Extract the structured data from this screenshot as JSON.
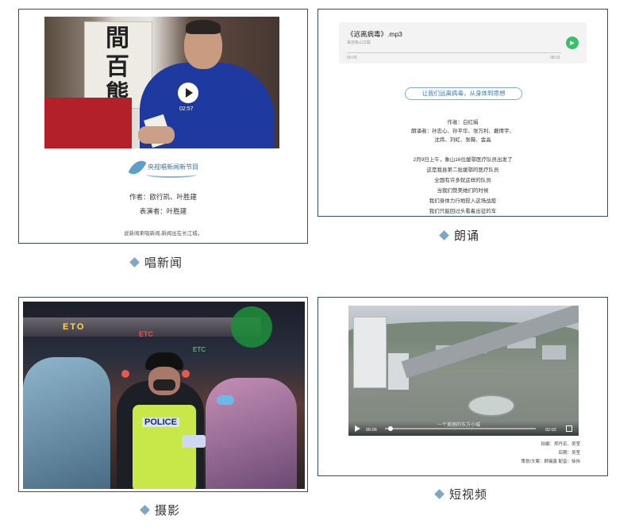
{
  "card1": {
    "calligraphy": [
      "間",
      "百",
      "態"
    ],
    "video_time": "02:57",
    "badge": "央视唱新闻新节目",
    "authors": "作者：欧行凯、叶胜建",
    "performer": "表演者：叶胜建",
    "snippet": "说新闻来唱新闻,新闻出在长江城，"
  },
  "card2": {
    "audio_title": "《远离病毒》.mp3",
    "audio_subtitle": "来自象山文联",
    "time_start": "00:00",
    "time_end": "08:03",
    "pill": "让我们远离病毒，从身体到思想",
    "poem": [
      "作者：白红娟",
      "朗诵者：孙忠心、孙平华、张万利、戴倩宇、",
      "沈炜、刘虹、张薇、金晶",
      "",
      "2月9日上午，象山16位援鄂医疗队员出发了",
      "这是我县第二批援鄂的医疗队员",
      "全国有许多就这样的队员",
      "当我们赞美她们的时候",
      "我们身体力行地投入这场战疫",
      "我们只能回过头看着出征的车"
    ]
  },
  "card3": {
    "sign_yellow": "ETO",
    "sign_red": "ETC",
    "sign_green": "ETC",
    "vest": "POLICE"
  },
  "card4": {
    "time_start": "00:06",
    "time_end": "02:02",
    "subtitle": "一个美丽的东方小城",
    "credits": [
      "拍摄：郑丹宏、吴莹",
      "后期：吴莹",
      "策划/文案：顾锡鑫  配音：徐伟"
    ]
  },
  "captions": {
    "c1": "唱新闻",
    "c2": "朗诵",
    "c3": "摄影",
    "c4": "短视频"
  },
  "colors": {
    "card_border": "#2f4f6a",
    "diamond": "#7fa7c4",
    "audio_play": "#3bbf6b",
    "pill_border": "#7ab2d1"
  }
}
